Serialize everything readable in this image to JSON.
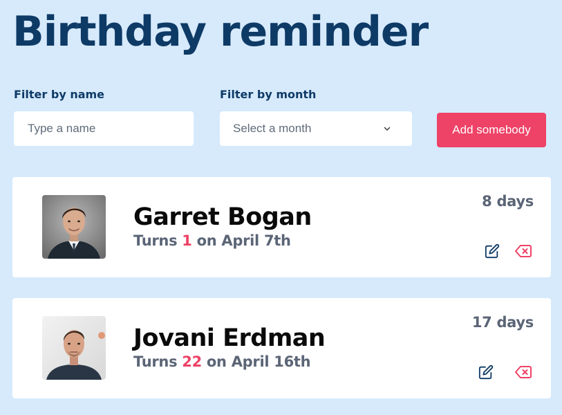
{
  "app": {
    "title": "Birthday reminder"
  },
  "filters": {
    "name_label": "Filter by name",
    "name_placeholder": "Type a name",
    "name_value": "",
    "month_label": "Filter by month",
    "month_selected": "Select a month"
  },
  "actions": {
    "add_label": "Add somebody"
  },
  "colors": {
    "background": "#d6eafc",
    "heading": "#0e3a66",
    "accent": "#ee4266",
    "muted_text": "#5b6576",
    "card": "#ffffff"
  },
  "people": [
    {
      "name": "Garret Bogan",
      "turns_prefix": "Turns ",
      "age": "1",
      "on_text": " on April 7th",
      "days": "8 days",
      "avatar_icon": "person-photo-avatar",
      "edit_icon": "edit-icon",
      "delete_icon": "backspace-delete-icon"
    },
    {
      "name": "Jovani Erdman",
      "turns_prefix": "Turns ",
      "age": "22",
      "on_text": " on April 16th",
      "days": "17 days",
      "avatar_icon": "person-photo-avatar",
      "edit_icon": "edit-icon",
      "delete_icon": "backspace-delete-icon"
    }
  ]
}
